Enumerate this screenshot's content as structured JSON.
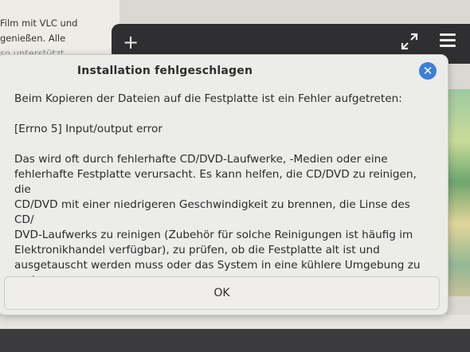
{
  "background": {
    "left_text_lines": [
      "Film mit VLC und",
      "genießen. Alle",
      "so unterstützt"
    ],
    "header_icons": [
      "plus-icon",
      "expand-icon",
      "menu-icon"
    ]
  },
  "dialog": {
    "title": "Installation fehlgeschlagen",
    "close_icon": "close-icon",
    "message": "Beim Kopieren der Dateien auf die Festplatte ist ein Fehler aufgetreten:",
    "error": "[Errno 5] Input/output error",
    "detail": "Das wird oft durch fehlerhafte CD/DVD-Laufwerke, -Medien oder eine\nfehlerhafte Festplatte verursacht. Es kann helfen, die CD/DVD zu reinigen, die\nCD/DVD mit einer niedrigeren Geschwindigkeit zu brennen, die Linse des CD/\nDVD-Laufwerks zu reinigen (Zubehör für solche Reinigungen ist häufig im\nElektronikhandel verfügbar), zu prüfen, ob die Festplatte alt ist und\nausgetauscht werden muss oder das System in eine kühlere Umgebung zu\nverlagern.",
    "ok_label": "OK"
  },
  "colors": {
    "accent": "#3b7fd9",
    "header_bg": "#2f2f31",
    "dialog_bg": "#ececea"
  }
}
